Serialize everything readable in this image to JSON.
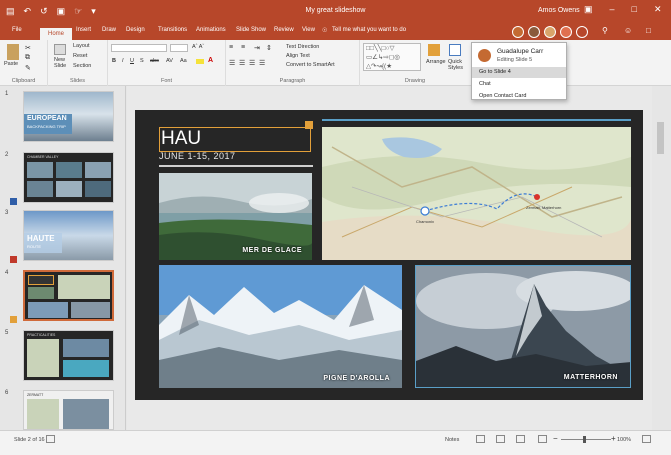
{
  "window": {
    "title": "My great slideshow",
    "user": "Amos Owens"
  },
  "tabs": [
    "File",
    "Home",
    "Insert",
    "Draw",
    "Design",
    "Transitions",
    "Animations",
    "Slide Show",
    "Review",
    "View"
  ],
  "tell_me": "Tell me what you want to do",
  "ribbon": {
    "groups": {
      "clipboard": "Clipboard",
      "slides": "Slides",
      "font": "Font",
      "paragraph": "Paragraph",
      "drawing": "Drawing"
    },
    "paste": "Paste",
    "new_slide": "New Slide",
    "layout": "Layout",
    "reset": "Reset",
    "section": "Section",
    "text_direction": "Text Direction",
    "align_text": "Align Text",
    "convert_smartart": "Convert to SmartArt",
    "arrange": "Arrange",
    "quick_styles": "Quick Styles"
  },
  "popup": {
    "name": "Guadalupe Carr",
    "status": "Editing Slide 5",
    "items": [
      "Go to Slide 4",
      "Chat",
      "Open Contact Card"
    ]
  },
  "thumbnails": [
    {
      "number": "1",
      "title": "EUROPEAN",
      "subtitle": "BACKPACKING TRIP"
    },
    {
      "number": "2",
      "title": "CHAMBER VALLEY"
    },
    {
      "number": "3",
      "title": "HAUTE",
      "subtitle": "ROUTE"
    },
    {
      "number": "4"
    },
    {
      "number": "5",
      "title": "PRACTICALITIES"
    },
    {
      "number": "6",
      "title": "ZERMATT"
    }
  ],
  "slide": {
    "title": "HAU",
    "date": "JUNE 1-15, 2017",
    "captions": {
      "lake": "MER DE GLACE",
      "glacier": "PIGNE D'AROLLA",
      "matterhorn": "MATTERHORN"
    },
    "map_labels": {
      "start": "Chamonix",
      "end": "Zermatt, Matterhorn"
    }
  },
  "status": {
    "slide_count": "Slide 2 of 16",
    "notes": "Notes",
    "zoom": "100%"
  },
  "colors": {
    "accent": "#b7472a",
    "slide_bg": "#262626",
    "title_border": "#e2a03a",
    "rule": "#5a9fc7"
  }
}
